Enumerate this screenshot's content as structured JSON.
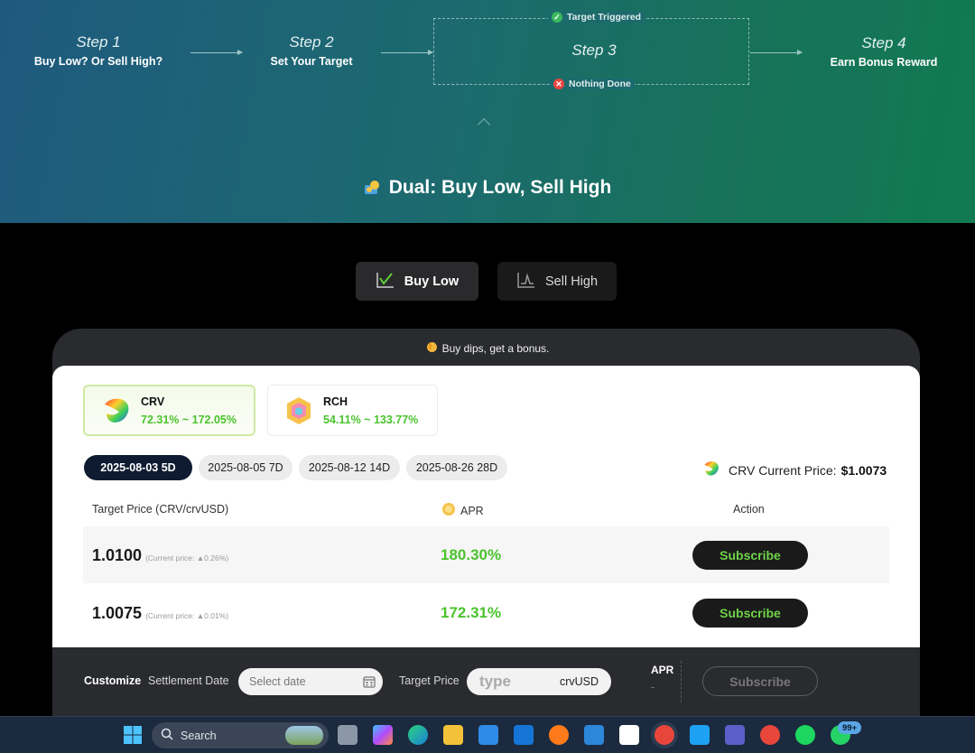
{
  "steps": [
    {
      "num": "Step 1",
      "label": "Buy Low?  Or Sell High?"
    },
    {
      "num": "Step 2",
      "label": "Set Your Target"
    },
    {
      "num": "Step 3",
      "label": ""
    },
    {
      "num": "Step 4",
      "label": "Earn Bonus Reward"
    }
  ],
  "step3_outcomes": {
    "triggered": "Target Triggered",
    "nothing": "Nothing Done"
  },
  "hero_title": "Dual: Buy Low, Sell High",
  "modes": {
    "buy_low": "Buy Low",
    "sell_high": "Sell High",
    "active": "buy_low"
  },
  "panel_note": "Buy dips, get a bonus.",
  "coins": [
    {
      "symbol": "CRV",
      "apr_range": "72.31% ~ 172.05%",
      "selected": true
    },
    {
      "symbol": "RCH",
      "apr_range": "54.11% ~ 133.77%",
      "selected": false
    }
  ],
  "dates": [
    {
      "label": "2025-08-03 5D",
      "active": true
    },
    {
      "label": "2025-08-05 7D",
      "active": false
    },
    {
      "label": "2025-08-12 14D",
      "active": false
    },
    {
      "label": "2025-08-26 28D",
      "active": false
    }
  ],
  "current_price": {
    "label": "CRV Current Price:",
    "value": "$1.0073"
  },
  "table": {
    "headers": {
      "target": "Target Price (CRV/crvUSD)",
      "apr": "APR",
      "action": "Action"
    },
    "rows": [
      {
        "price": "1.0100",
        "note": "(Current price: ▲0.26%)",
        "apr": "180.30%",
        "action": "Subscribe"
      },
      {
        "price": "1.0075",
        "note": "(Current price: ▲0.01%)",
        "apr": "172.31%",
        "action": "Subscribe"
      }
    ]
  },
  "customize": {
    "title": "Customize",
    "settlement_label": "Settlement Date",
    "date_placeholder": "Select date",
    "target_label": "Target Price",
    "price_placeholder": "type",
    "unit": "crvUSD",
    "apr_label": "APR",
    "apr_value": "-",
    "subscribe": "Subscribe"
  },
  "taskbar": {
    "search_placeholder": "Search",
    "badge": "99+"
  },
  "colors": {
    "accent_green": "#4ac32c",
    "hero_start": "#1f5a7e",
    "hero_end": "#117a52",
    "dark_pill": "#0f1b31"
  }
}
